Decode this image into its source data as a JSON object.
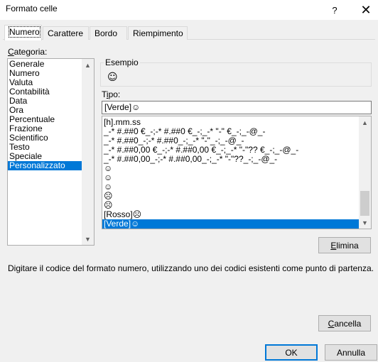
{
  "window": {
    "title": "Formato celle",
    "help_glyph": "?",
    "close_glyph": "✕"
  },
  "tabs": [
    {
      "label": "Numero",
      "active": true
    },
    {
      "label": "Carattere",
      "active": false
    },
    {
      "label": "Bordo",
      "active": false
    },
    {
      "label": "Riempimento",
      "active": false
    }
  ],
  "categoria": {
    "label_first": "C",
    "label_rest": "ategoria:",
    "items": [
      "Generale",
      "Numero",
      "Valuta",
      "Contabilità",
      "Data",
      "Ora",
      "Percentuale",
      "Frazione",
      "Scientifico",
      "Testo",
      "Speciale",
      "Personalizzato"
    ],
    "selected_index": 11
  },
  "esempio": {
    "title": "Esempio",
    "value": "☺"
  },
  "tipo": {
    "label_first": "T",
    "label_underlined": "i",
    "label_rest": "po:",
    "value": "[Verde]☺",
    "formats": [
      "[h].mm.ss",
      "_-* #.##0 €_-;-* #.##0 €_-;_-* \"-\" €_-;_-@_-",
      "_-* #.##0_-;-* #.##0_-;_-* \"-\"_-;_-@_-",
      "_-* #.##0,00 €_-;-* #.##0,00 €_-;_-* \"-\"?? €_-;_-@_-",
      "_-* #.##0,00_-;-* #.##0,00_-;_-* \"-\"??_-;_-@_-",
      "☺",
      "☺",
      "☺",
      "☹",
      "☹",
      "[Rosso]☹",
      "[Verde]☺"
    ],
    "selected_index": 11
  },
  "buttons": {
    "elimina": "Elimina",
    "cancella": "Cancella",
    "ok": "OK",
    "annulla": "Annulla"
  },
  "description": "Digitare il codice del formato numero, utilizzando uno dei codici esistenti come punto di partenza.",
  "colors": {
    "selection": "#0078d7",
    "background": "#f0f0f0"
  }
}
